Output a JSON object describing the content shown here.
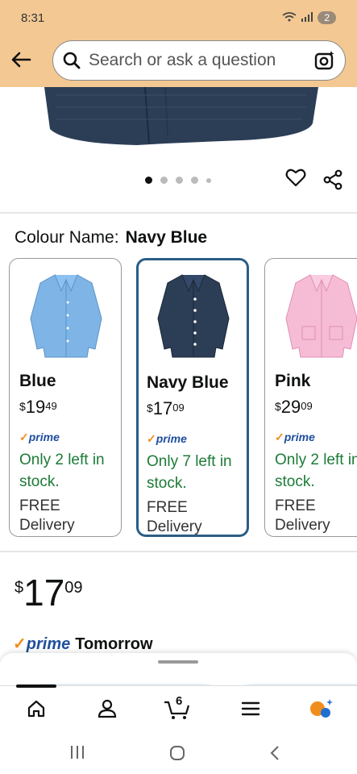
{
  "status_bar": {
    "time": "8:31",
    "battery": "2"
  },
  "search": {
    "placeholder": "Search or ask a question"
  },
  "gallery": {
    "dots_total": 5,
    "active_index": 0
  },
  "colour": {
    "label": "Colour Name:",
    "selected": "Navy Blue"
  },
  "options": [
    {
      "name": "Blue",
      "currency": "$",
      "price_whole": "19",
      "price_fraction": "49",
      "prime": "prime",
      "stock": "Only 2 left in stock.",
      "free": "FREE",
      "delivery": "Delivery"
    },
    {
      "name": "Navy Blue",
      "currency": "$",
      "price_whole": "17",
      "price_fraction": "09",
      "prime": "prime",
      "stock": "Only 7 left in stock.",
      "free": "FREE",
      "delivery": "Delivery"
    },
    {
      "name": "Pink",
      "currency": "$",
      "price_whole": "29",
      "price_fraction": "09",
      "prime": "prime",
      "stock": "Only 2 left in stock.",
      "free": "FREE",
      "delivery": "Delivery"
    }
  ],
  "price": {
    "currency": "$",
    "whole": "17",
    "fraction": "09"
  },
  "prime_delivery": {
    "brand": "prime",
    "day": "Tomorrow"
  },
  "nav": {
    "cart_count": "6"
  },
  "colors": {
    "header": "#f3c893",
    "prime_blue": "#1f4e9c",
    "prime_check": "#f08d1c",
    "stock_green": "#1c7b37",
    "selected_border": "#2a5d86",
    "swatch_blue": "#7fb5e6",
    "swatch_navy": "#2c3e56",
    "swatch_pink": "#f6bcd6"
  }
}
